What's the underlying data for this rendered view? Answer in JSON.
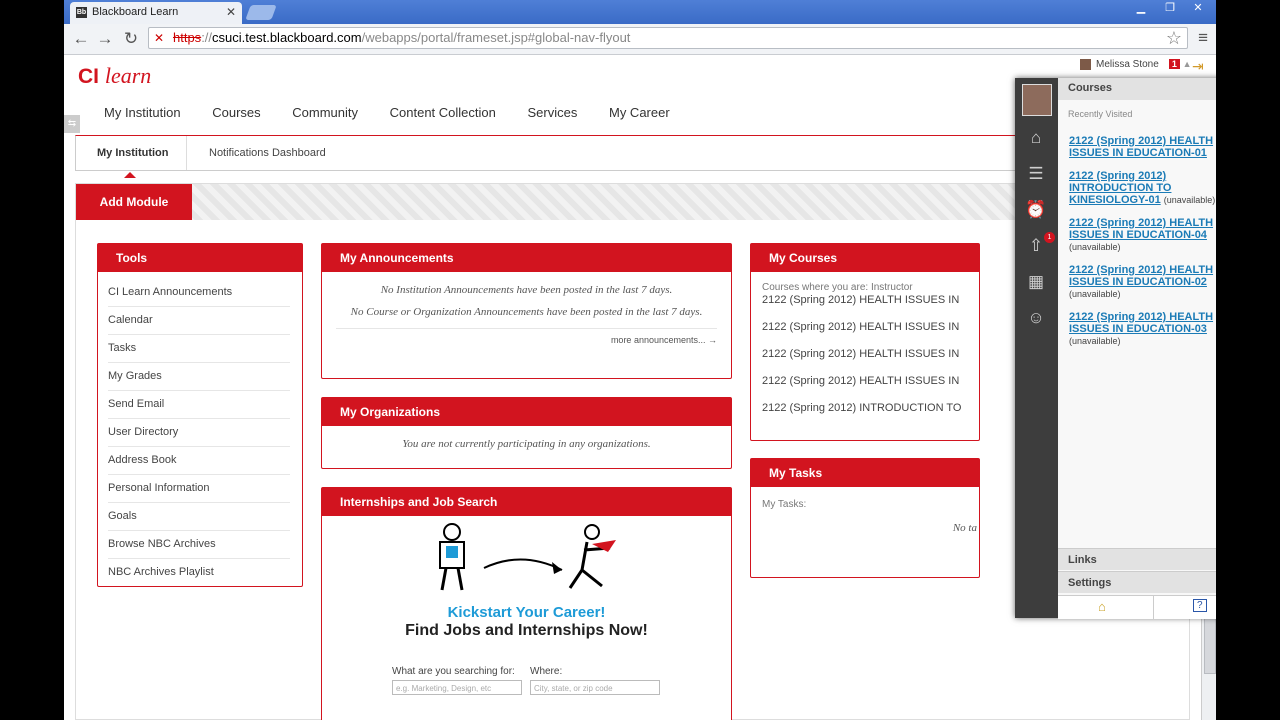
{
  "browser": {
    "tab_title": "Blackboard Learn",
    "tab_favicon": "Bb",
    "tab_close": "✕",
    "url_scheme": "https",
    "url_sep": "://",
    "url_host": "csuci.test.blackboard.com",
    "url_path": "/webapps/portal/frameset.jsp#global-nav-flyout",
    "win_min": "▁",
    "win_max": "❐",
    "win_close": "✕"
  },
  "header": {
    "logo_ci": "CI",
    "logo_learn": "learn",
    "user_name": "Melissa Stone",
    "notification_count": "1"
  },
  "main_nav": [
    "My Institution",
    "Courses",
    "Community",
    "Content Collection",
    "Services",
    "My Career"
  ],
  "sub_tabs": {
    "active": "My Institution",
    "second": "Notifications Dashboard"
  },
  "add_module_label": "Add Module",
  "tools": {
    "title": "Tools",
    "items": [
      "CI Learn Announcements",
      "Calendar",
      "Tasks",
      "My Grades",
      "Send Email",
      "User Directory",
      "Address Book",
      "Personal Information",
      "Goals",
      "Browse NBC Archives",
      "NBC Archives Playlist"
    ]
  },
  "announcements": {
    "title": "My Announcements",
    "msg1": "No Institution Announcements have been posted in the last 7 days.",
    "msg2": "No Course or Organization Announcements have been posted in the last 7 days.",
    "more": "more announcements... →"
  },
  "organizations": {
    "title": "My Organizations",
    "msg": "You are not currently participating in any organizations."
  },
  "internships": {
    "title": "Internships and Job Search",
    "kickstart": "Kickstart Your Career!",
    "find": "Find Jobs and Internships Now!",
    "search_label": "What are you searching for:",
    "where_label": "Where:",
    "search_placeholder": "e.g. Marketing, Design, etc",
    "where_placeholder": "City, state, or zip code"
  },
  "my_courses": {
    "title": "My Courses",
    "role_label": "Courses where you are: Instructor",
    "items": [
      "2122 (Spring 2012) HEALTH ISSUES IN",
      "2122 (Spring 2012) HEALTH ISSUES IN",
      "2122 (Spring 2012) HEALTH ISSUES IN",
      "2122 (Spring 2012) HEALTH ISSUES IN",
      "2122 (Spring 2012) INTRODUCTION TO"
    ]
  },
  "my_tasks": {
    "title": "My Tasks",
    "label": "My Tasks:",
    "msg": "No ta"
  },
  "flyout": {
    "header": "Courses",
    "recently_visited": "Recently Visited",
    "notification_badge": "1",
    "courses": [
      {
        "name": "2122 (Spring 2012) HEALTH ISSUES IN EDUCATION-01",
        "status": ""
      },
      {
        "name": "2122 (Spring 2012) INTRODUCTION TO KINESIOLOGY-01",
        "status": "(unavailable)"
      },
      {
        "name": "2122 (Spring 2012) HEALTH ISSUES IN EDUCATION-04",
        "status": "(unavailable)"
      },
      {
        "name": "2122 (Spring 2012) HEALTH ISSUES IN EDUCATION-02",
        "status": "(unavailable)"
      },
      {
        "name": "2122 (Spring 2012) HEALTH ISSUES IN EDUCATION-03",
        "status": "(unavailable)"
      }
    ],
    "links_label": "Links",
    "settings_label": "Settings"
  },
  "colors": {
    "brand_red": "#d2141f",
    "link_blue": "#1b7bb6",
    "accent_blue": "#1e9bd7"
  }
}
